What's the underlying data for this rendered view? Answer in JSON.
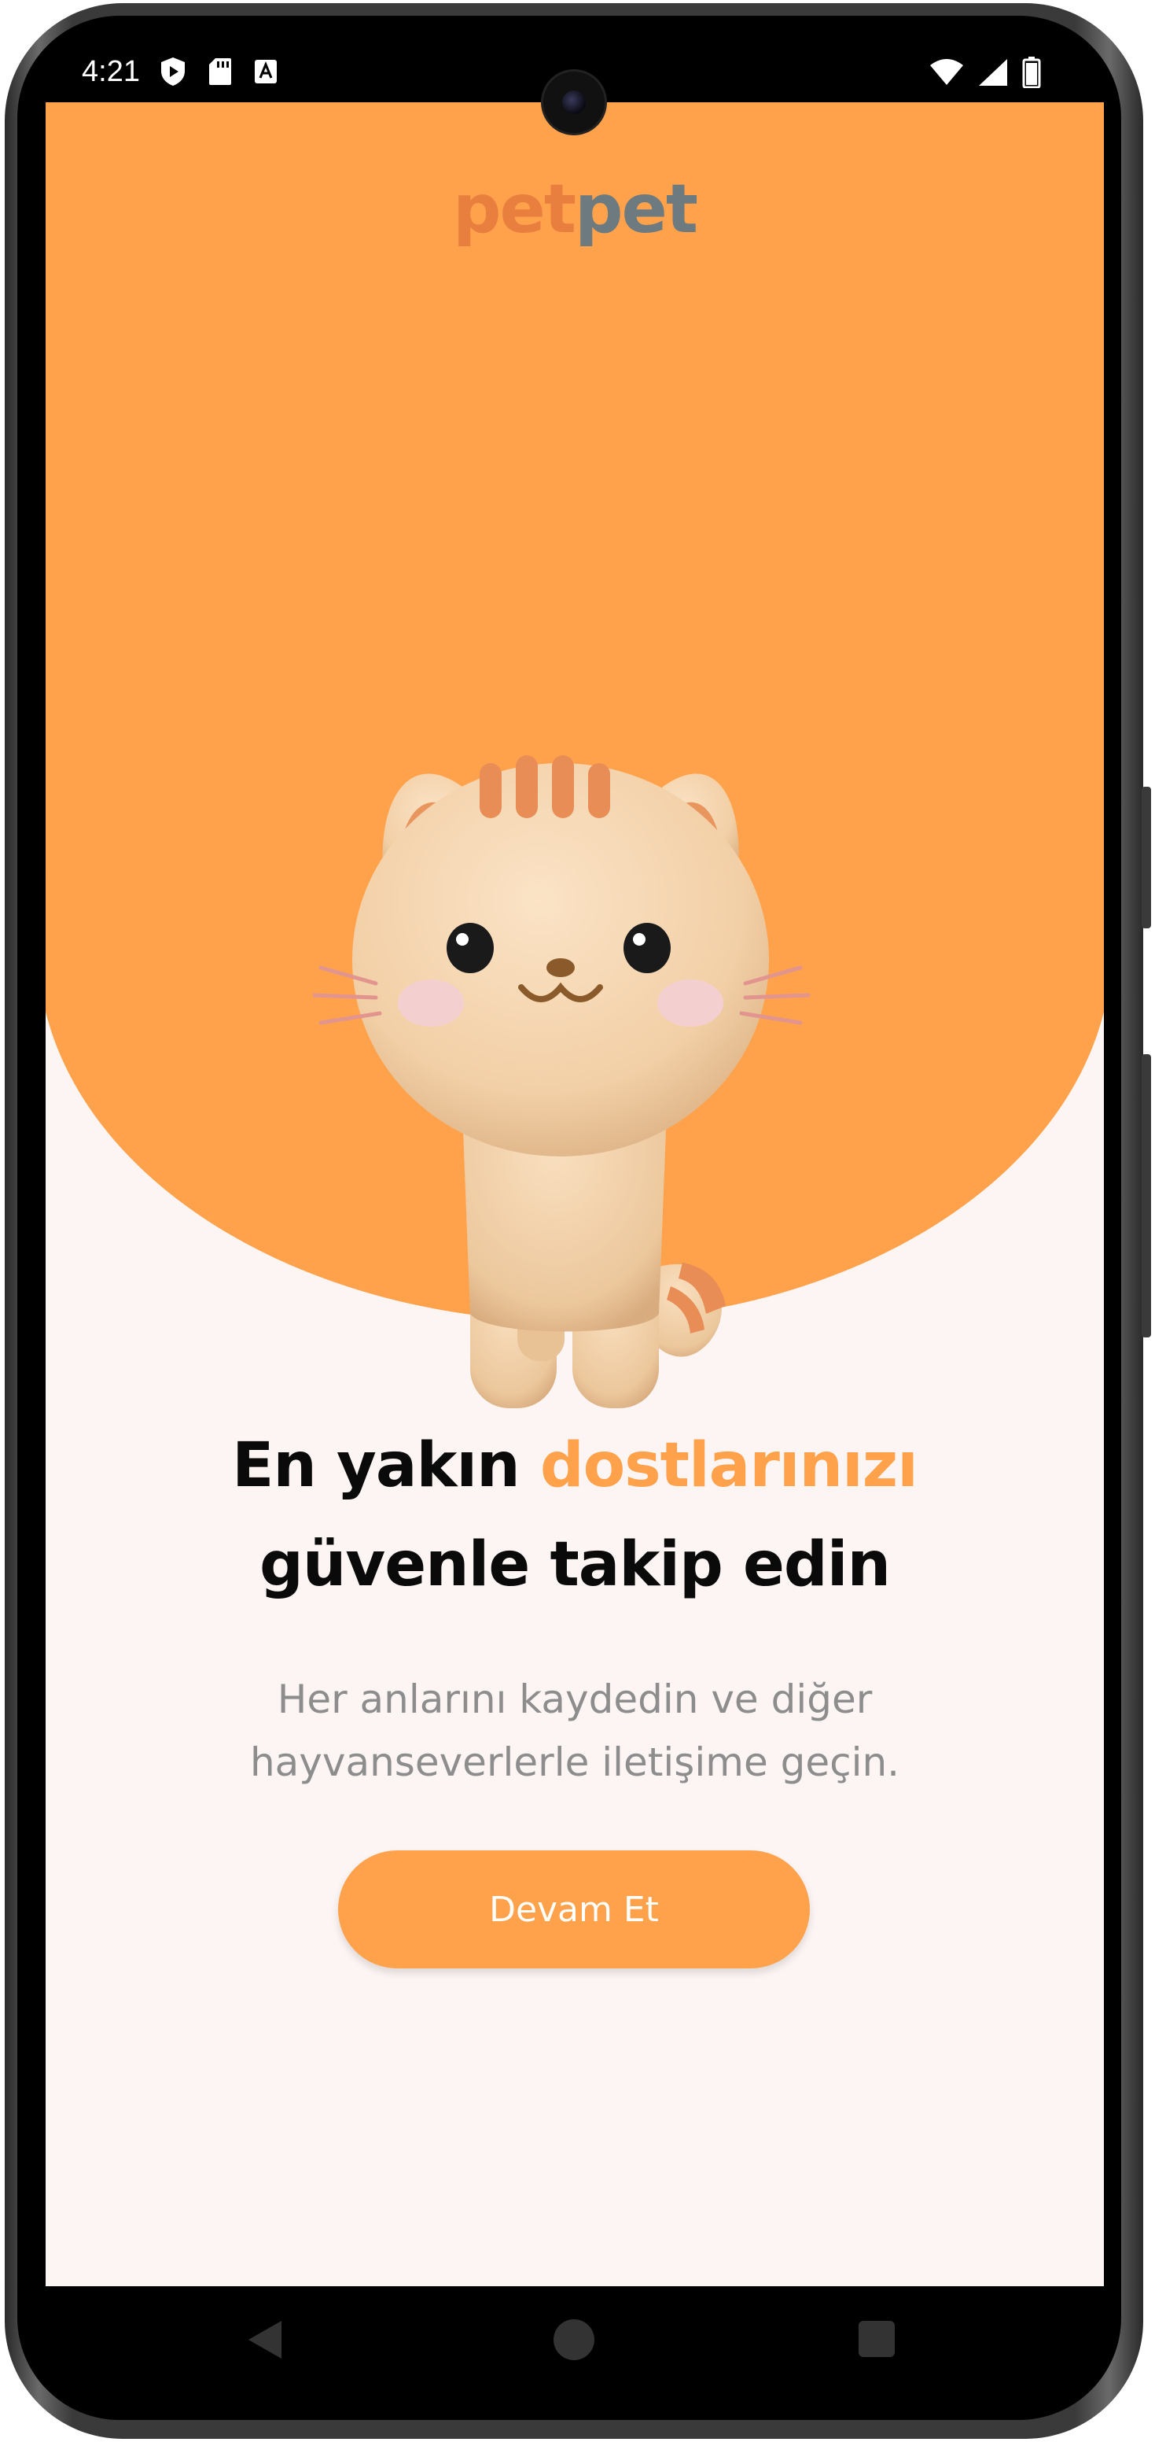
{
  "status_bar": {
    "time": "4:21",
    "left_icons": [
      "shield-play-icon",
      "sd-card-icon",
      "a-box-icon"
    ],
    "right_icons": [
      "wifi-icon",
      "cell-signal-icon",
      "battery-icon"
    ]
  },
  "brand": {
    "logo_part1": "pet",
    "logo_part2": "pet",
    "accent_color": "#ffa24b",
    "background_color": "#fcf5f3"
  },
  "hero": {
    "image": "cat-illustration"
  },
  "headline": {
    "part1": "En yakın ",
    "accent": "dostlarınızı",
    "part2": "güvenle takip edin"
  },
  "subtitle": {
    "line1": "Her anlarını kaydedin ve diğer",
    "line2": "hayvanseverlerle iletişime geçin."
  },
  "cta": {
    "label": "Devam Et"
  },
  "nav_bar": {
    "back": "back-icon",
    "home": "home-icon",
    "recents": "recents-icon"
  }
}
